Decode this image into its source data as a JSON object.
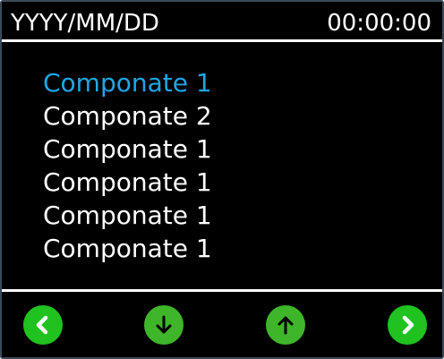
{
  "header": {
    "date": "YYYY/MM/DD",
    "time": "00:00:00"
  },
  "menu": {
    "items": [
      {
        "label": "Componate 1",
        "selected": true
      },
      {
        "label": "Componate 2",
        "selected": false
      },
      {
        "label": "Componate 1",
        "selected": false
      },
      {
        "label": "Componate 1",
        "selected": false
      },
      {
        "label": "Componate 1",
        "selected": false
      },
      {
        "label": "Componate 1",
        "selected": false
      }
    ]
  },
  "footer": {
    "buttons": [
      {
        "name": "previous",
        "icon": "chevron-left-icon"
      },
      {
        "name": "scroll-down",
        "icon": "arrow-down-icon"
      },
      {
        "name": "scroll-up",
        "icon": "arrow-up-icon"
      },
      {
        "name": "next",
        "icon": "chevron-right-icon"
      }
    ]
  },
  "colors": {
    "background": "#000000",
    "text": "#ffffff",
    "selected_text": "#1ea7e6",
    "button_green": "#1fc21f",
    "button_green_alt": "#3fb52a"
  }
}
